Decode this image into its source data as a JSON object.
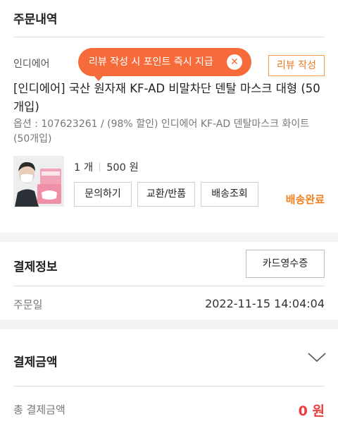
{
  "order_history": {
    "title": "주문내역",
    "seller": "인디에어",
    "tooltip": "리뷰 작성 시 포인트 즉시 지급",
    "review_button": "리뷰 작성",
    "product_name": "[인디에어] 국산 원자재 KF-AD 비말차단 덴탈 마스크 대형 (50개입)",
    "option": "옵션 : 107623261 / (98% 할인) 인디에어 KF-AD 덴탈마스크 화이트 (50개입)",
    "quantity": "1 개",
    "price": "500 원",
    "buttons": {
      "inquiry": "문의하기",
      "exchange": "교환/반품",
      "tracking": "배송조회"
    },
    "status": "배송완료"
  },
  "payment_info": {
    "title": "결제정보",
    "receipt_button": "카드영수증",
    "order_date_label": "주문일",
    "order_date": "2022-11-15 14:04:04"
  },
  "payment_amount": {
    "title": "결제금액",
    "total_label": "총 결제금액",
    "total": "0 원"
  },
  "icons": {
    "tooltip_close": "close-icon",
    "expand": "chevron-down-icon",
    "thumbnail": "product-thumbnail"
  },
  "colors": {
    "accent": "#f56b3a",
    "status": "#f08020",
    "amount": "#ee3b3b"
  }
}
